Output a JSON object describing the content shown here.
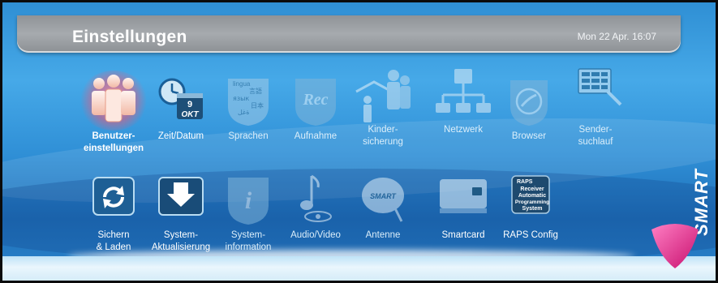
{
  "header": {
    "title": "Einstellungen",
    "datetime": "Mon 22 Apr. 16:07"
  },
  "icons": {
    "clock_line1": "9",
    "clock_line2": "OKT",
    "rec_text": "Rec",
    "info_letter": "i",
    "antenna_brand": "SMART",
    "raps_lines": [
      "RAPS",
      "Receiver",
      "Automatic",
      "Programming",
      "System"
    ],
    "sprachen_words": [
      "lingua",
      "言語",
      "язык",
      "日本",
      "ةغل"
    ]
  },
  "menu": {
    "row1": [
      {
        "label": "Benutzer-\neinstellungen",
        "icon": "users-icon",
        "selected": true
      },
      {
        "label": "Zeit/Datum",
        "icon": "clock-calendar-icon"
      },
      {
        "label": "Sprachen",
        "icon": "languages-icon"
      },
      {
        "label": "Aufnahme",
        "icon": "record-icon"
      },
      {
        "label": "Kinder-\nsicherung",
        "icon": "parental-lock-icon"
      },
      {
        "label": "Netzwerk",
        "icon": "network-icon"
      },
      {
        "label": "Browser",
        "icon": "browser-globe-icon"
      },
      {
        "label": "Sender-\nsuchlauf",
        "icon": "channel-search-icon"
      }
    ],
    "row2": [
      {
        "label": "Sichern\n& Laden",
        "icon": "backup-restore-icon"
      },
      {
        "label": "System-\nAktualisierung",
        "icon": "system-update-icon"
      },
      {
        "label": "System-\ninformation",
        "icon": "info-icon"
      },
      {
        "label": "Audio/Video",
        "icon": "audio-video-icon"
      },
      {
        "label": "Antenne",
        "icon": "satellite-dish-icon"
      },
      {
        "label": "Smartcard",
        "icon": "smartcard-icon"
      },
      {
        "label": "RAPS Config",
        "icon": "raps-config-icon"
      }
    ]
  },
  "brand": {
    "vertical_logo": "SMART"
  },
  "colors": {
    "background": "#2f8fd4",
    "header": "#9ea2a6",
    "selected_glow": "#ff6a86"
  }
}
